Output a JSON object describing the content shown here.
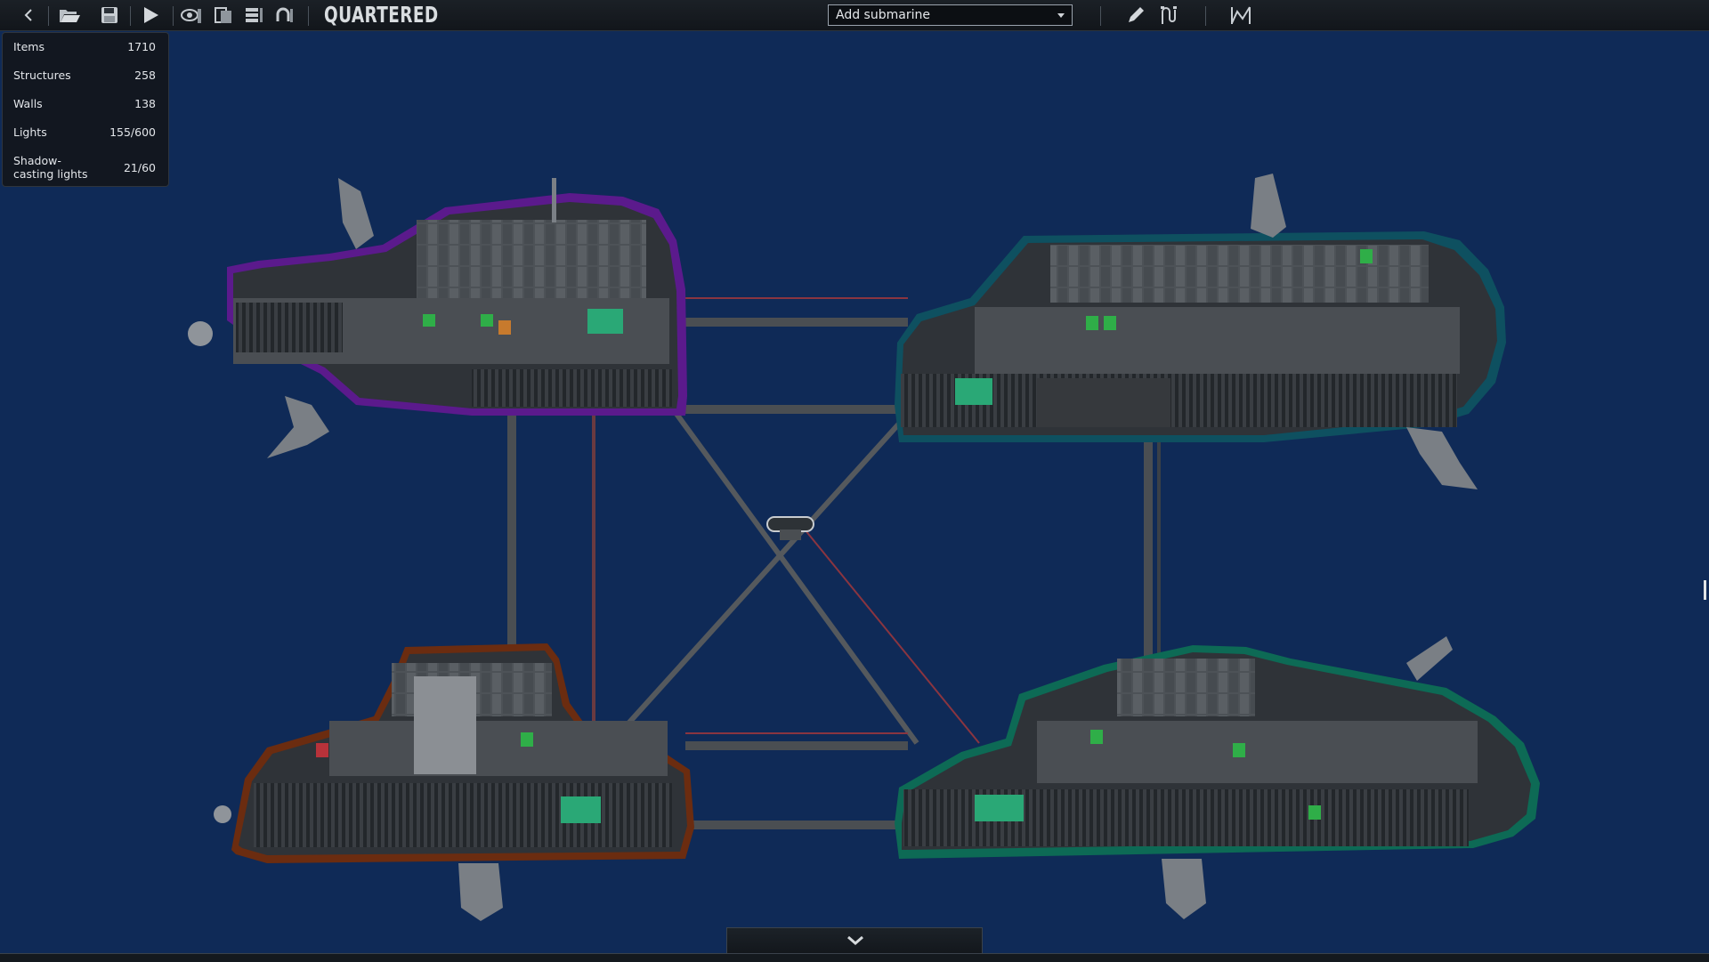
{
  "toolbar": {
    "submarine_name": "QUARTERED",
    "add_submarine": "Add submarine",
    "icons": [
      "back-icon",
      "open-folder-icon",
      "save-icon",
      "play-icon",
      "visibility-icon",
      "layers-icon",
      "list-icon",
      "undo-icon",
      "pencil-icon",
      "wire-icon",
      "waypoint-icon"
    ]
  },
  "stats": [
    {
      "label": "Items",
      "value": "1710"
    },
    {
      "label": "Structures",
      "value": "258"
    },
    {
      "label": "Walls",
      "value": "138"
    },
    {
      "label": "Lights",
      "value": "155/600"
    },
    {
      "label": "Shadow-casting lights",
      "value": "21/60"
    }
  ],
  "colors": {
    "background": "#0f2a57",
    "hull_purple": "#5b1a8c",
    "hull_teal": "#0e5060",
    "hull_brown": "#6b2c10",
    "hull_green": "#0d6a55",
    "interior": "#2f3338",
    "room": "#4a4e53",
    "toolbar": "#161b20"
  }
}
